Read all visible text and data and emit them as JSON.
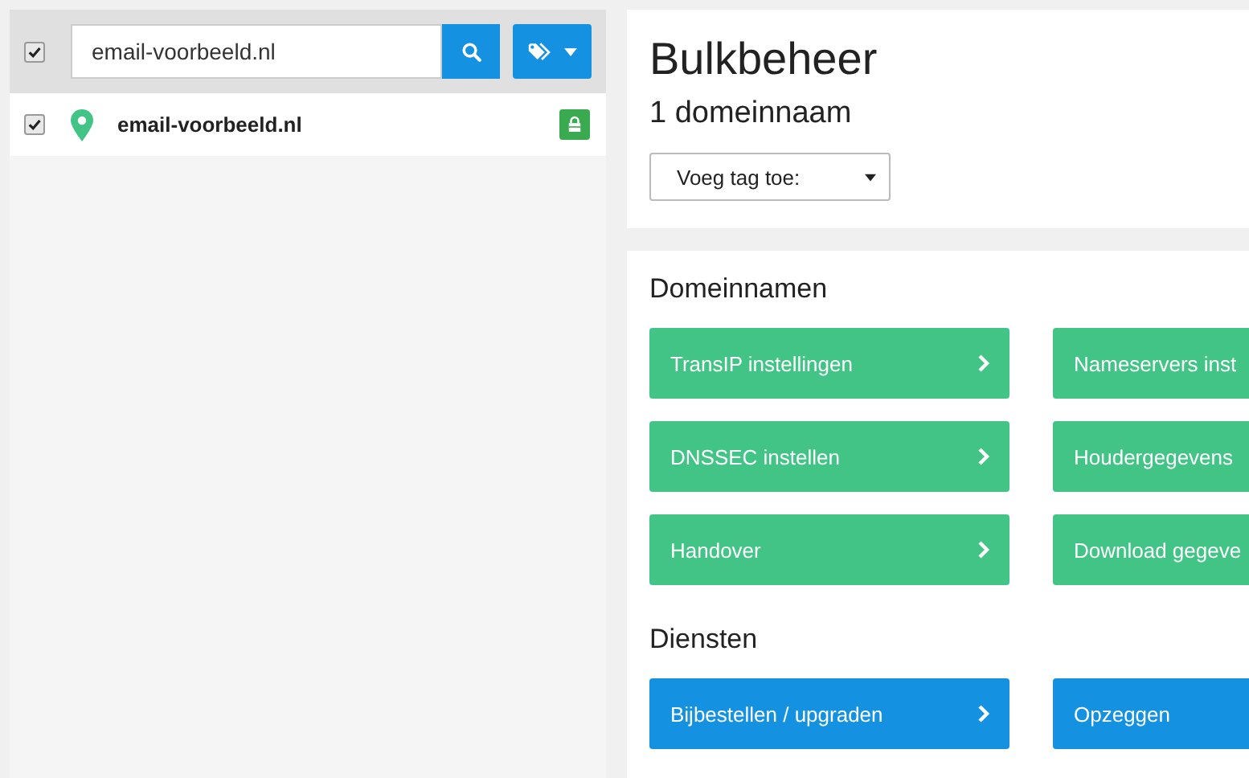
{
  "toolbar": {
    "select_all": {
      "checked": true
    },
    "search": {
      "value": "email-voorbeeld.nl"
    }
  },
  "domains": [
    {
      "name": "email-voorbeeld.nl",
      "checked": true,
      "locked": true
    }
  ],
  "header": {
    "title": "Bulkbeheer",
    "subtitle": "1 domeinnaam",
    "tag_select": {
      "value": "Voeg tag toe:"
    }
  },
  "sections": [
    {
      "title": "Domeinnamen",
      "color": "#41c485",
      "buttons": [
        {
          "label": "TransIP instellingen"
        },
        {
          "label": "Nameservers inst"
        },
        {
          "label": "DNSSEC instellen"
        },
        {
          "label": "Houdergegevens"
        },
        {
          "label": "Handover"
        },
        {
          "label": "Download gegeve"
        }
      ]
    },
    {
      "title": "Diensten",
      "color": "#1591e1",
      "buttons": [
        {
          "label": "Bijbestellen / upgraden"
        },
        {
          "label": "Opzeggen"
        }
      ]
    }
  ]
}
